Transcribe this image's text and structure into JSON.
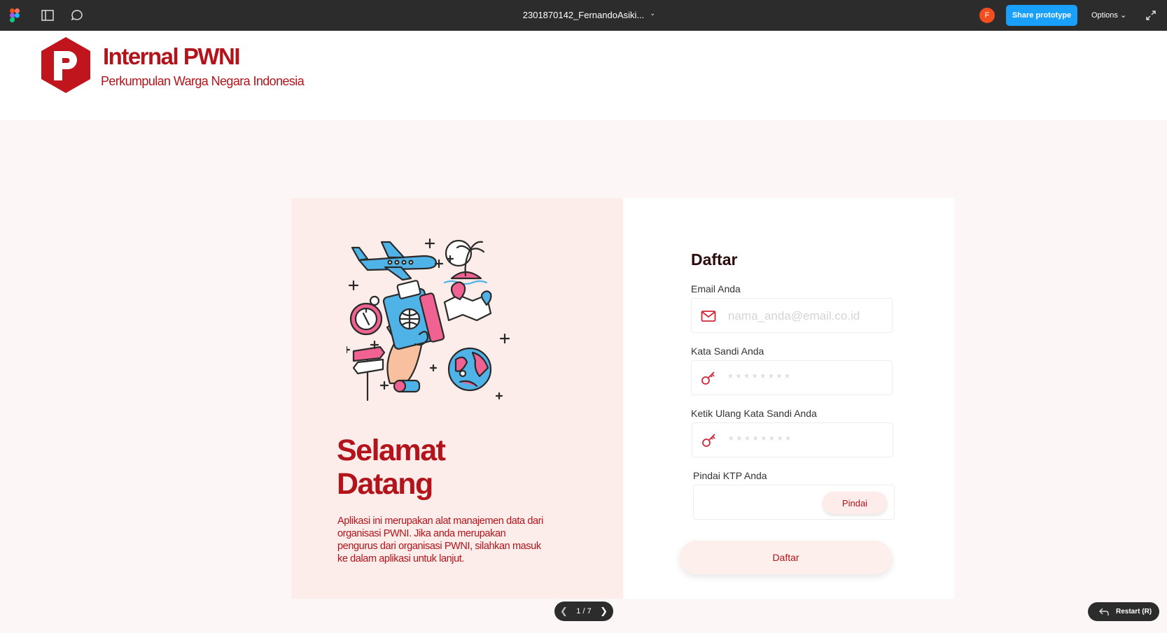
{
  "toolbar": {
    "file_name": "2301870142_FernandoAsiki...",
    "avatar_initial": "F",
    "share_label": "Share prototype",
    "options_label": "Options"
  },
  "brand": {
    "title": "Internal PWNI",
    "subtitle": "Perkumpulan Warga Negara Indonesia",
    "color": "#b3141b"
  },
  "welcome": {
    "line1": "Selamat",
    "line2": "Datang",
    "description": "Aplikasi ini merupakan alat manajemen data dari organisasi PWNI. Jika anda merupakan pengurus dari organisasi PWNI, silahkan masuk ke dalam aplikasi untuk lanjut."
  },
  "form": {
    "title": "Daftar",
    "email_label": "Email Anda",
    "email_placeholder": "nama_anda@email.co.id",
    "password_label": "Kata Sandi Anda",
    "password_placeholder": "********",
    "confirm_label": "Ketik Ulang Kata Sandi Anda",
    "confirm_placeholder": "********",
    "ktp_label": "Pindai KTP Anda",
    "scan_button": "Pindai",
    "submit_button": "Daftar"
  },
  "prototype_nav": {
    "page_indicator": "1 / 7",
    "restart_label": "Restart (R)"
  },
  "icons": {
    "email": "mail-icon",
    "password": "key-icon",
    "confirm": "key-icon"
  }
}
